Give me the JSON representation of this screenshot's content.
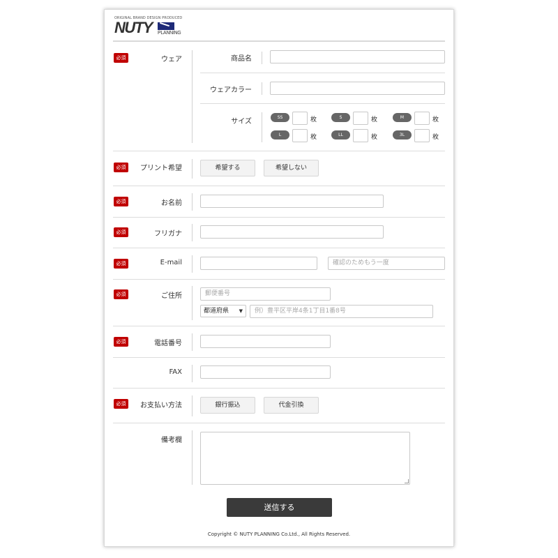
{
  "logo": {
    "tagline": "ORIGINAL BRAND DESIGN PRODUCED",
    "main": "NUTY",
    "sub": "PLANNING"
  },
  "required_badge": "必須",
  "sections": {
    "wear": {
      "label": "ウェア",
      "product_name_label": "商品名",
      "wear_color_label": "ウェアカラー",
      "size_label": "サイズ",
      "sizes": [
        "SS",
        "S",
        "M",
        "L",
        "LL",
        "3L"
      ],
      "unit": "枚"
    },
    "print": {
      "label": "プリント希望",
      "options": [
        "希望する",
        "希望しない"
      ]
    },
    "name": {
      "label": "お名前"
    },
    "furigana": {
      "label": "フリガナ"
    },
    "email": {
      "label": "E-mail",
      "confirm_placeholder": "確認のためもう一度"
    },
    "address": {
      "label": "ご住所",
      "postal_placeholder": "郵便番号",
      "prefecture_selected": "都道府県",
      "address_placeholder": "例）豊平区平岸4条1丁目1番8号"
    },
    "phone": {
      "label": "電話番号"
    },
    "fax": {
      "label": "FAX"
    },
    "payment": {
      "label": "お支払い方法",
      "options": [
        "銀行振込",
        "代金引換"
      ]
    },
    "notes": {
      "label": "備考欄"
    }
  },
  "submit_label": "送信する",
  "copyright": "Copyright © NUTY PLANNING Co.Ltd., All Rights Reserved.",
  "colors": {
    "required": "#c00000",
    "submit": "#3a3a3a",
    "pill": "#666666"
  }
}
